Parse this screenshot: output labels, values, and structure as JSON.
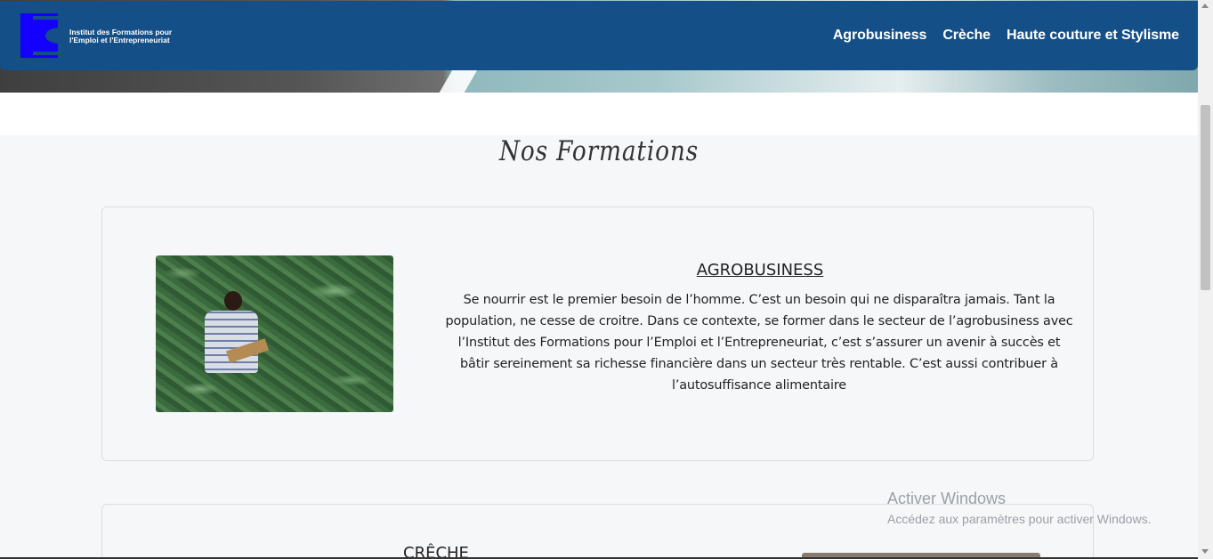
{
  "navbar": {
    "logo_text_line1": "Institut des Formations pour",
    "logo_text_line2": "l'Emploi et l'Entrepreneuriat",
    "links": [
      "Agrobusiness",
      "Crèche",
      "Haute couture et Stylisme"
    ],
    "background_color": "#144f87",
    "logo_color": "#1400ff"
  },
  "section": {
    "title": "Nos Formations"
  },
  "cards": [
    {
      "title": "AGROBUSINESS",
      "text": "Se nourrir est le premier besoin de l’homme. C’est un besoin qui ne disparaîtra jamais. Tant la population, ne cesse de croitre. Dans ce contexte, se former dans le secteur de l’agrobusiness avec l’Institut des Formations pour l’Emploi et l’Entrepreneuriat, c’est s’assurer un avenir à succès et bâtir sereinement sa richesse financière dans un secteur très rentable. C’est aussi contribuer à l’autosuffisance alimentaire"
    },
    {
      "title": "CRÊCHE"
    }
  ],
  "watermark": {
    "title": "Activer Windows",
    "subtitle": "Accédez aux paramètres pour activer Windows."
  }
}
